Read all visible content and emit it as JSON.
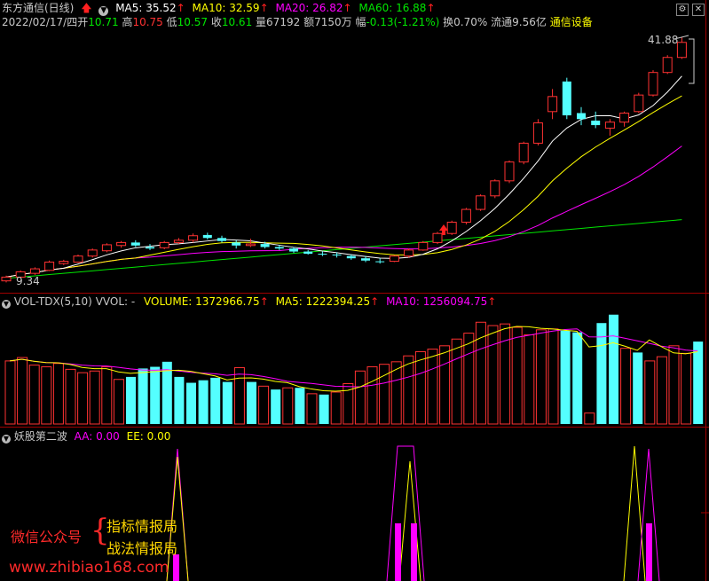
{
  "title_bar": {
    "name": "东方通信(日线)",
    "ma5_label": "MA5: 35.52",
    "ma10_label": "MA10: 32.59",
    "ma20_label": "MA20: 26.82",
    "ma60_label": "MA60: 16.88",
    "up_arrow": "↑"
  },
  "info_bar": {
    "date": "2022/02/17/四",
    "open_label": "开",
    "open": "10.71",
    "high_label": "高",
    "high": "10.75",
    "low_label": "低",
    "low": "10.57",
    "close_label": "收",
    "close": "10.61",
    "vol_label": "量",
    "vol": "67192",
    "amt_label": "额",
    "amt": "7150万",
    "chg_label": "幅",
    "chg": "-0.13(-1.21%)",
    "turnover": "换0.70%",
    "float_cap": "流通9.56亿",
    "sector": "通信设备"
  },
  "price_panel": {
    "high_mark": "41.88",
    "low_mark": "9.34"
  },
  "volume_panel": {
    "name": "VOL-TDX(5,10)",
    "vvol": "VVOL: -",
    "volume": "VOLUME: 1372966.75",
    "ma5": "MA5: 1222394.25",
    "ma10": "MA10: 1256094.75",
    "up_arrow": "↑"
  },
  "indicator_panel": {
    "name": "妖股第二波",
    "aa": "AA: 0.00",
    "ee": "EE: 0.00"
  },
  "watermark": {
    "line1": "微信公众号",
    "brace": "{",
    "line2": "指标情报局",
    "line3": "战法情报局",
    "url": "www.zhibiao168.com"
  },
  "buttons": {
    "settings": "⚙",
    "close": "✕"
  },
  "colors": {
    "up": "#ff3232",
    "down": "#54ffff",
    "ma5": "#ffffff",
    "ma10": "#ffff00",
    "ma20": "#ff00ff",
    "ma60": "#00e600",
    "grid": "#a00000"
  },
  "chart_data": {
    "type": "candlestick",
    "candles": [
      [
        9.5,
        10.2,
        9.3,
        10.0
      ],
      [
        10.0,
        10.9,
        9.9,
        10.7
      ],
      [
        10.5,
        11.3,
        10.3,
        11.1
      ],
      [
        10.9,
        12.2,
        10.8,
        12.0
      ],
      [
        11.8,
        12.3,
        11.6,
        12.1
      ],
      [
        12.0,
        13.0,
        11.9,
        12.8
      ],
      [
        12.8,
        13.8,
        12.6,
        13.6
      ],
      [
        13.5,
        14.5,
        13.3,
        14.3
      ],
      [
        14.2,
        14.8,
        13.9,
        14.6
      ],
      [
        14.6,
        14.9,
        14.0,
        14.2
      ],
      [
        14.0,
        14.4,
        13.6,
        13.8
      ],
      [
        13.9,
        14.8,
        13.7,
        14.6
      ],
      [
        14.6,
        15.2,
        14.4,
        14.9
      ],
      [
        14.9,
        15.8,
        14.6,
        15.5
      ],
      [
        15.6,
        15.9,
        15.0,
        15.2
      ],
      [
        15.2,
        15.5,
        14.6,
        14.8
      ],
      [
        14.6,
        14.9,
        13.8,
        14.2
      ],
      [
        14.2,
        15.1,
        14.0,
        14.4
      ],
      [
        14.4,
        14.7,
        13.8,
        14.0
      ],
      [
        14.0,
        14.3,
        13.6,
        13.8
      ],
      [
        13.8,
        14.0,
        13.2,
        13.4
      ],
      [
        13.4,
        13.6,
        13.0,
        13.1
      ],
      [
        13.1,
        13.4,
        12.8,
        13.0
      ],
      [
        13.0,
        13.3,
        12.6,
        12.9
      ],
      [
        12.8,
        13.0,
        12.3,
        12.5
      ],
      [
        12.5,
        12.8,
        12.0,
        12.2
      ],
      [
        12.1,
        12.5,
        11.8,
        12.0
      ],
      [
        12.1,
        12.9,
        12.0,
        12.8
      ],
      [
        12.8,
        13.8,
        12.6,
        13.6
      ],
      [
        13.6,
        14.8,
        13.5,
        14.6
      ],
      [
        14.6,
        16.0,
        14.4,
        15.8
      ],
      [
        15.8,
        17.5,
        15.6,
        17.3
      ],
      [
        17.3,
        19.2,
        17.0,
        19.0
      ],
      [
        19.0,
        21.0,
        18.8,
        20.8
      ],
      [
        20.8,
        23.0,
        20.5,
        22.8
      ],
      [
        22.8,
        25.5,
        22.5,
        25.3
      ],
      [
        25.3,
        28.0,
        25.0,
        27.8
      ],
      [
        27.8,
        31.0,
        27.5,
        30.5
      ],
      [
        32.0,
        35.0,
        31.0,
        34.0
      ],
      [
        36.0,
        36.5,
        31.0,
        31.5
      ],
      [
        31.8,
        32.6,
        30.2,
        31.0
      ],
      [
        30.8,
        32.0,
        29.8,
        30.2
      ],
      [
        29.8,
        31.0,
        28.8,
        30.6
      ],
      [
        30.6,
        32.0,
        30.0,
        31.8
      ],
      [
        32.0,
        34.5,
        31.8,
        34.2
      ],
      [
        34.2,
        37.5,
        34.0,
        37.2
      ],
      [
        37.2,
        39.5,
        37.0,
        39.2
      ],
      [
        39.2,
        41.88,
        39.0,
        41.2
      ]
    ],
    "volumes": [
      7.5,
      7.9,
      7.0,
      6.8,
      7.2,
      6.5,
      6.1,
      6.3,
      6.8,
      5.3,
      5.6,
      6.6,
      6.8,
      7.4,
      5.6,
      4.9,
      5.2,
      5.5,
      5.0,
      6.7,
      5.0,
      4.5,
      4.1,
      4.3,
      4.3,
      3.6,
      3.5,
      3.8,
      4.8,
      6.3,
      6.8,
      7.1,
      7.4,
      8.1,
      8.6,
      8.9,
      9.3,
      10.1,
      10.8,
      12.1,
      11.7,
      11.9,
      11.5,
      10.6,
      11.2,
      11.3,
      11.1,
      10.9,
      1.3,
      12.0,
      13.0,
      9.0,
      8.5,
      7.5,
      8.0,
      9.3,
      8.4,
      9.8
    ],
    "y_range_price": [
      9.34,
      41.88
    ]
  }
}
